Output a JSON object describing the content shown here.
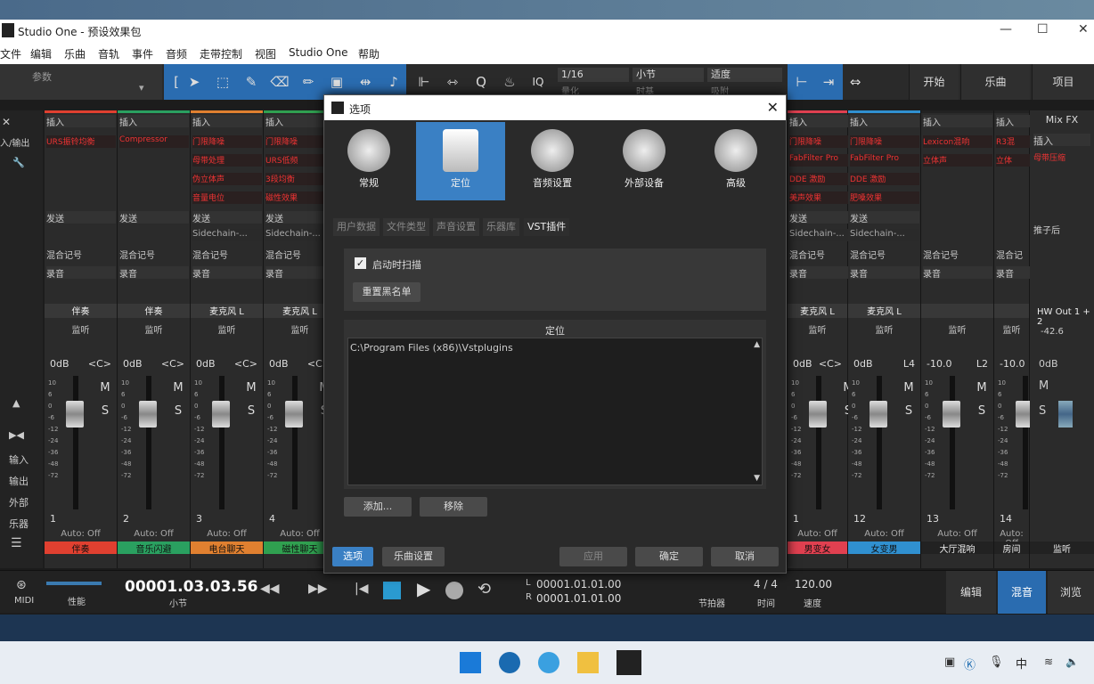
{
  "window": {
    "title": "Studio One - 预设效果包"
  },
  "menu": [
    "文件",
    "编辑",
    "乐曲",
    "音轨",
    "事件",
    "音频",
    "走带控制",
    "视图",
    "Studio One",
    "帮助"
  ],
  "toolbar": {
    "param_label": "参数",
    "quantize_value": "1/16",
    "quantize_label": "量化",
    "timebase_value": "小节",
    "timebase_label": "时基",
    "snap_value": "适度",
    "snap_label": "吸附",
    "nav": [
      "开始",
      "乐曲",
      "项目"
    ]
  },
  "left_panel": {
    "labels": [
      "输入",
      "输出",
      "外部",
      "乐器"
    ],
    "io_label": "入/输出"
  },
  "strips": [
    {
      "insert": "插入",
      "slots": [
        "URS振铃均衡"
      ],
      "send": "发送",
      "mix": "混合记号",
      "rec": "录音",
      "name": "伴奏",
      "mon": "监听",
      "vol": "0dB",
      "pan": "<C>",
      "num": "1",
      "auto": "Auto: Off",
      "label": "伴奏",
      "color": "#e04030"
    },
    {
      "insert": "插入",
      "slots": [
        "Compressor"
      ],
      "send": "发送",
      "mix": "混合记号",
      "rec": "录音",
      "name": "伴奏",
      "mon": "监听",
      "vol": "0dB",
      "pan": "<C>",
      "num": "2",
      "auto": "Auto: Off",
      "label": "音乐闪避",
      "color": "#2aa060"
    },
    {
      "insert": "插入",
      "slots": [
        "门限降噪",
        "母带处理",
        "伪立体声",
        "音量电位"
      ],
      "send": "发送",
      "sidechain": "Sidechain-...",
      "mix": "混合记号",
      "rec": "录音",
      "name": "麦克风 L",
      "mon": "监听",
      "vol": "0dB",
      "pan": "<C>",
      "num": "3",
      "auto": "Auto: Off",
      "label": "电台聊天",
      "color": "#e08030"
    },
    {
      "insert": "插入",
      "slots": [
        "门限降噪",
        "URS低频",
        "3段均衡",
        "磁性效果"
      ],
      "send": "发送",
      "sidechain": "Sidechain-...",
      "mix": "混合记号",
      "rec": "录音",
      "name": "麦克风 L",
      "mon": "监听",
      "vol": "0dB",
      "pan": "<C>",
      "num": "4",
      "auto": "Auto: Off",
      "label": "磁性聊天",
      "color": "#30a050"
    },
    {
      "insert": "插入",
      "slots": [
        "门限降噪",
        "FabFilter Pro",
        "DDE 激励",
        "美声效果"
      ],
      "send": "发送",
      "sidechain": "Sidechain-...",
      "mix": "混合记号",
      "rec": "录音",
      "name": "麦克风 L",
      "mon": "监听",
      "vol": "0dB",
      "pan": "<C>",
      "num": "1",
      "auto": "Auto: Off",
      "label": "男变女",
      "color": "#e04050"
    },
    {
      "insert": "插入",
      "slots": [
        "门限降噪",
        "FabFilter Pro",
        "DDE 激励",
        "肥嗓效果"
      ],
      "send": "发送",
      "sidechain": "Sidechain-...",
      "mix": "混合记号",
      "rec": "录音",
      "name": "麦克风 L",
      "mon": "监听",
      "vol": "0dB",
      "pan": "L4",
      "num": "12",
      "auto": "Auto: Off",
      "label": "女变男",
      "color": "#3090d0"
    },
    {
      "insert": "插入",
      "slots": [
        "Lexicon混响",
        "立体声"
      ],
      "send": "",
      "mix": "混合记号",
      "rec": "录音",
      "name": "",
      "mon": "监听",
      "vol": "-10.0",
      "pan": "L2",
      "num": "13",
      "auto": "Auto: Off",
      "label": "大厅混响",
      "color": "#222"
    },
    {
      "insert": "插入",
      "slots": [
        "R3混",
        "立体"
      ],
      "send": "",
      "mix": "混合记",
      "rec": "录音",
      "name": "",
      "mon": "监听",
      "vol": "-10.0",
      "pan": "",
      "num": "14",
      "auto": "Auto: Off",
      "label": "房间",
      "color": "#222"
    }
  ],
  "mixfx": {
    "title": "Mix FX",
    "insert": "插入",
    "slot": "母带压缩",
    "post": "推子后",
    "out": "HW Out 1 + 2",
    "vol": "0dB",
    "lr": "-42.6",
    "label": "监听"
  },
  "dialog": {
    "title": "选项",
    "categories": [
      "常规",
      "定位",
      "音频设置",
      "外部设备",
      "高级"
    ],
    "subtabs": [
      "用户数据",
      "文件类型",
      "声音设置",
      "乐器库",
      "VST插件"
    ],
    "scan_label": "启动时扫描",
    "reset_btn": "重置黑名单",
    "locate_header": "定位",
    "path": "C:\\Program Files (x86)\\Vstplugins",
    "add_btn": "添加...",
    "remove_btn": "移除",
    "footer": {
      "options": "选项",
      "song": "乐曲设置",
      "apply": "应用",
      "ok": "确定",
      "cancel": "取消"
    }
  },
  "transport": {
    "midi": "MIDI",
    "perf": "性能",
    "time": "00001.03.03.56",
    "time_label": "小节",
    "L": "00001.01.01.00",
    "R": "00001.01.01.00",
    "metronome": "节拍器",
    "sig": "4 / 4",
    "sig_label": "时间",
    "tempo": "120.00",
    "tempo_label": "速度",
    "views": [
      "编辑",
      "混音",
      "浏览"
    ]
  },
  "taskbar": {
    "ime": "中"
  }
}
